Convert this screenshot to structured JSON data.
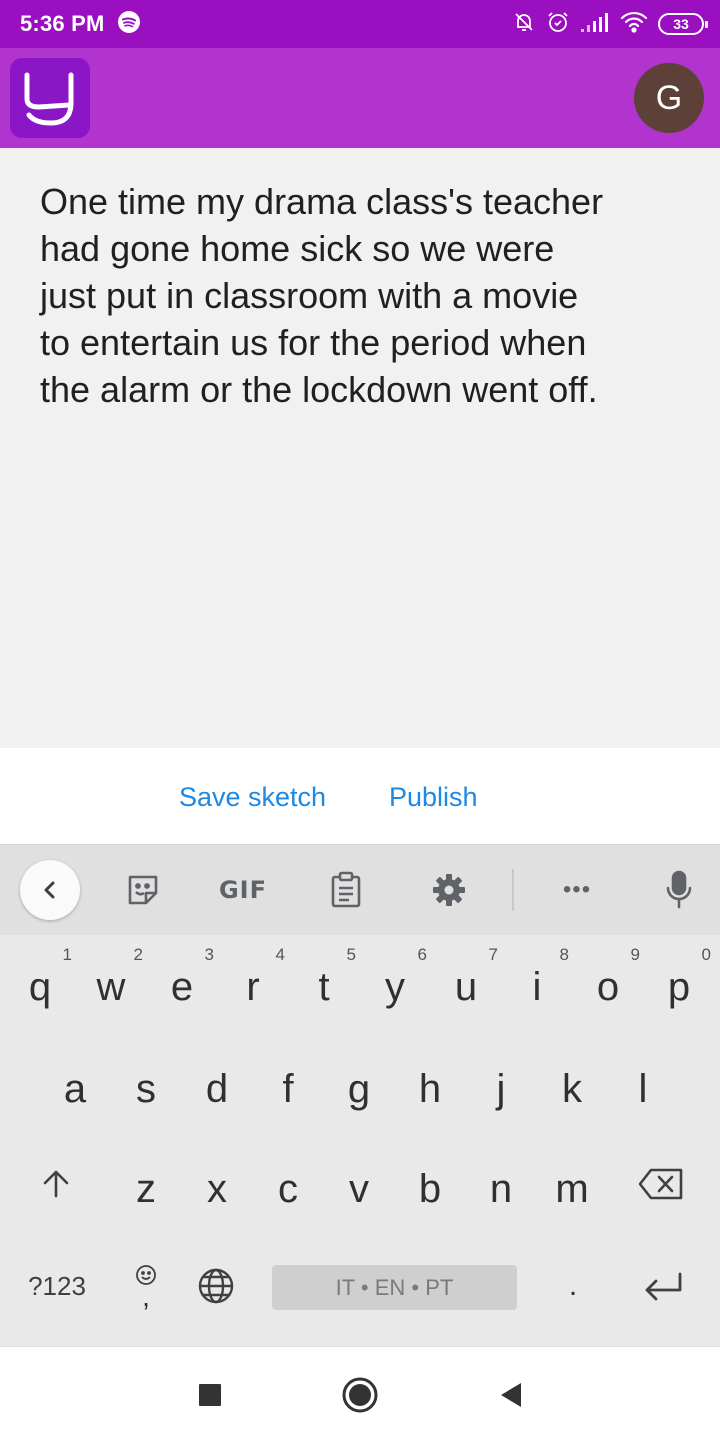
{
  "status_bar": {
    "time": "5:36 PM",
    "battery": "33"
  },
  "app_bar": {
    "avatar_initial": "G"
  },
  "story": {
    "lines": [
      "One time my drama class's teacher",
      "had gone home sick so we were",
      "just put in classroom with a movie",
      "to entertain us for the period when",
      "the alarm or the lockdown went off."
    ]
  },
  "actions": {
    "save_label": "Save sketch",
    "publish_label": "Publish"
  },
  "keyboard": {
    "toolbar": {
      "gif_label": "GIF",
      "more_label": "•••"
    },
    "row1": [
      {
        "ch": "q",
        "hint": "1"
      },
      {
        "ch": "w",
        "hint": "2"
      },
      {
        "ch": "e",
        "hint": "3"
      },
      {
        "ch": "r",
        "hint": "4"
      },
      {
        "ch": "t",
        "hint": "5"
      },
      {
        "ch": "y",
        "hint": "6"
      },
      {
        "ch": "u",
        "hint": "7"
      },
      {
        "ch": "i",
        "hint": "8"
      },
      {
        "ch": "o",
        "hint": "9"
      },
      {
        "ch": "p",
        "hint": "0"
      }
    ],
    "row2": [
      "a",
      "s",
      "d",
      "f",
      "g",
      "h",
      "j",
      "k",
      "l"
    ],
    "row3": [
      "z",
      "x",
      "c",
      "v",
      "b",
      "n",
      "m"
    ],
    "symbols_label": "?123",
    "comma_label": ",",
    "space_label": "IT • EN • PT",
    "period_label": "."
  },
  "icons": {
    "app_logo": "app-logo",
    "spotify": "spotify-icon",
    "mute": "bell-off-icon",
    "alarm": "alarm-icon",
    "signal": "signal-icon",
    "wifi": "wifi-icon"
  }
}
